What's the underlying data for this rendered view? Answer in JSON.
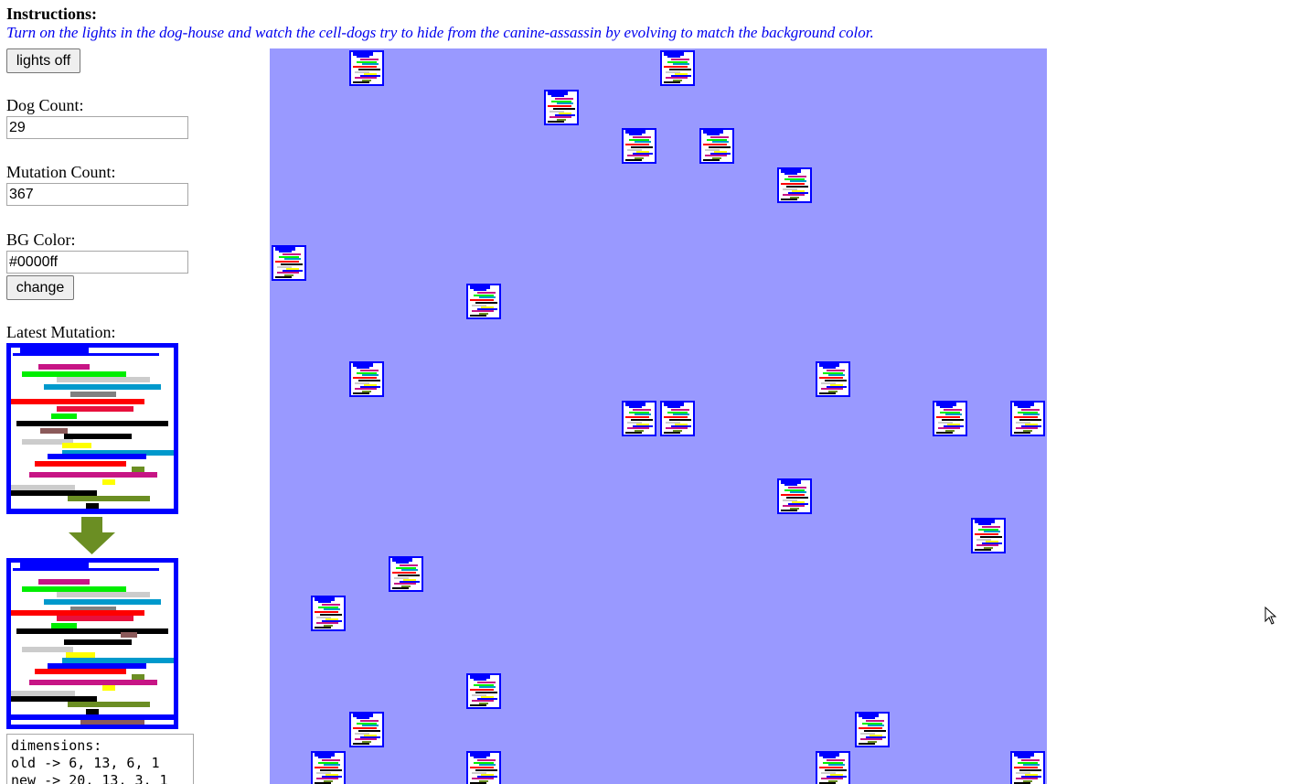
{
  "instructions": {
    "title": "Instructions:",
    "text": "Turn on the lights in the dog-house and watch the cell-dogs try to hide from the canine-assassin by evolving to match the background color."
  },
  "controls": {
    "lights_button": "lights off",
    "dog_count_label": "Dog Count:",
    "dog_count_value": "29",
    "mutation_count_label": "Mutation Count:",
    "mutation_count_value": "367",
    "bg_color_label": "BG Color:",
    "bg_color_value": "#0000ff",
    "change_button": "change",
    "latest_mutation_label": "Latest Mutation:"
  },
  "mutation_log": {
    "text": "dimensions:\nold -> 6, 13, 6, 1\nnew -> 20, 13, 3, 1"
  },
  "colors": {
    "doghouse_bg": "#9999ff",
    "dog_border": "#0000ff",
    "arrow": "#6b8e23",
    "instructions_text": "#0000ee"
  },
  "icons": {
    "arrow": "down-arrow-icon",
    "cursor": "mouse-pointer-icon"
  },
  "dog_house": {
    "dog_count": 29
  }
}
